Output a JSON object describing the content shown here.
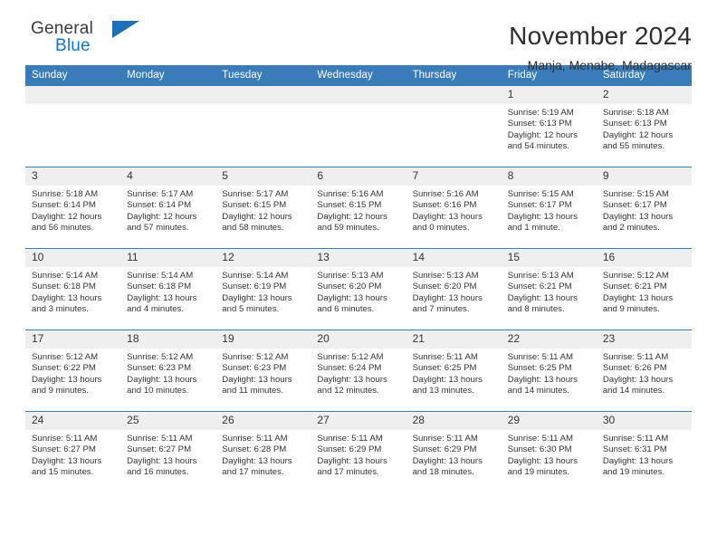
{
  "brand": {
    "name_part1": "General",
    "name_part2": "Blue",
    "accent_color": "#1277c4",
    "triangle_color": "#1f6fb6"
  },
  "header": {
    "title": "November 2024",
    "subtitle": "Manja, Menabe, Madagascar"
  },
  "theme": {
    "header_row_bg": "#3a7cba",
    "daynum_bg": "#efefef",
    "row_border": "#3a7cba"
  },
  "weekdays": [
    "Sunday",
    "Monday",
    "Tuesday",
    "Wednesday",
    "Thursday",
    "Friday",
    "Saturday"
  ],
  "labels": {
    "sunrise": "Sunrise:",
    "sunset": "Sunset:",
    "daylight": "Daylight:"
  },
  "weeks": [
    [
      {
        "day": "",
        "sunrise": "",
        "sunset": "",
        "daylight": ""
      },
      {
        "day": "",
        "sunrise": "",
        "sunset": "",
        "daylight": ""
      },
      {
        "day": "",
        "sunrise": "",
        "sunset": "",
        "daylight": ""
      },
      {
        "day": "",
        "sunrise": "",
        "sunset": "",
        "daylight": ""
      },
      {
        "day": "",
        "sunrise": "",
        "sunset": "",
        "daylight": ""
      },
      {
        "day": "1",
        "sunrise": "Sunrise: 5:19 AM",
        "sunset": "Sunset: 6:13 PM",
        "daylight": "Daylight: 12 hours and 54 minutes."
      },
      {
        "day": "2",
        "sunrise": "Sunrise: 5:18 AM",
        "sunset": "Sunset: 6:13 PM",
        "daylight": "Daylight: 12 hours and 55 minutes."
      }
    ],
    [
      {
        "day": "3",
        "sunrise": "Sunrise: 5:18 AM",
        "sunset": "Sunset: 6:14 PM",
        "daylight": "Daylight: 12 hours and 56 minutes."
      },
      {
        "day": "4",
        "sunrise": "Sunrise: 5:17 AM",
        "sunset": "Sunset: 6:14 PM",
        "daylight": "Daylight: 12 hours and 57 minutes."
      },
      {
        "day": "5",
        "sunrise": "Sunrise: 5:17 AM",
        "sunset": "Sunset: 6:15 PM",
        "daylight": "Daylight: 12 hours and 58 minutes."
      },
      {
        "day": "6",
        "sunrise": "Sunrise: 5:16 AM",
        "sunset": "Sunset: 6:15 PM",
        "daylight": "Daylight: 12 hours and 59 minutes."
      },
      {
        "day": "7",
        "sunrise": "Sunrise: 5:16 AM",
        "sunset": "Sunset: 6:16 PM",
        "daylight": "Daylight: 13 hours and 0 minutes."
      },
      {
        "day": "8",
        "sunrise": "Sunrise: 5:15 AM",
        "sunset": "Sunset: 6:17 PM",
        "daylight": "Daylight: 13 hours and 1 minute."
      },
      {
        "day": "9",
        "sunrise": "Sunrise: 5:15 AM",
        "sunset": "Sunset: 6:17 PM",
        "daylight": "Daylight: 13 hours and 2 minutes."
      }
    ],
    [
      {
        "day": "10",
        "sunrise": "Sunrise: 5:14 AM",
        "sunset": "Sunset: 6:18 PM",
        "daylight": "Daylight: 13 hours and 3 minutes."
      },
      {
        "day": "11",
        "sunrise": "Sunrise: 5:14 AM",
        "sunset": "Sunset: 6:18 PM",
        "daylight": "Daylight: 13 hours and 4 minutes."
      },
      {
        "day": "12",
        "sunrise": "Sunrise: 5:14 AM",
        "sunset": "Sunset: 6:19 PM",
        "daylight": "Daylight: 13 hours and 5 minutes."
      },
      {
        "day": "13",
        "sunrise": "Sunrise: 5:13 AM",
        "sunset": "Sunset: 6:20 PM",
        "daylight": "Daylight: 13 hours and 6 minutes."
      },
      {
        "day": "14",
        "sunrise": "Sunrise: 5:13 AM",
        "sunset": "Sunset: 6:20 PM",
        "daylight": "Daylight: 13 hours and 7 minutes."
      },
      {
        "day": "15",
        "sunrise": "Sunrise: 5:13 AM",
        "sunset": "Sunset: 6:21 PM",
        "daylight": "Daylight: 13 hours and 8 minutes."
      },
      {
        "day": "16",
        "sunrise": "Sunrise: 5:12 AM",
        "sunset": "Sunset: 6:21 PM",
        "daylight": "Daylight: 13 hours and 9 minutes."
      }
    ],
    [
      {
        "day": "17",
        "sunrise": "Sunrise: 5:12 AM",
        "sunset": "Sunset: 6:22 PM",
        "daylight": "Daylight: 13 hours and 9 minutes."
      },
      {
        "day": "18",
        "sunrise": "Sunrise: 5:12 AM",
        "sunset": "Sunset: 6:23 PM",
        "daylight": "Daylight: 13 hours and 10 minutes."
      },
      {
        "day": "19",
        "sunrise": "Sunrise: 5:12 AM",
        "sunset": "Sunset: 6:23 PM",
        "daylight": "Daylight: 13 hours and 11 minutes."
      },
      {
        "day": "20",
        "sunrise": "Sunrise: 5:12 AM",
        "sunset": "Sunset: 6:24 PM",
        "daylight": "Daylight: 13 hours and 12 minutes."
      },
      {
        "day": "21",
        "sunrise": "Sunrise: 5:11 AM",
        "sunset": "Sunset: 6:25 PM",
        "daylight": "Daylight: 13 hours and 13 minutes."
      },
      {
        "day": "22",
        "sunrise": "Sunrise: 5:11 AM",
        "sunset": "Sunset: 6:25 PM",
        "daylight": "Daylight: 13 hours and 14 minutes."
      },
      {
        "day": "23",
        "sunrise": "Sunrise: 5:11 AM",
        "sunset": "Sunset: 6:26 PM",
        "daylight": "Daylight: 13 hours and 14 minutes."
      }
    ],
    [
      {
        "day": "24",
        "sunrise": "Sunrise: 5:11 AM",
        "sunset": "Sunset: 6:27 PM",
        "daylight": "Daylight: 13 hours and 15 minutes."
      },
      {
        "day": "25",
        "sunrise": "Sunrise: 5:11 AM",
        "sunset": "Sunset: 6:27 PM",
        "daylight": "Daylight: 13 hours and 16 minutes."
      },
      {
        "day": "26",
        "sunrise": "Sunrise: 5:11 AM",
        "sunset": "Sunset: 6:28 PM",
        "daylight": "Daylight: 13 hours and 17 minutes."
      },
      {
        "day": "27",
        "sunrise": "Sunrise: 5:11 AM",
        "sunset": "Sunset: 6:29 PM",
        "daylight": "Daylight: 13 hours and 17 minutes."
      },
      {
        "day": "28",
        "sunrise": "Sunrise: 5:11 AM",
        "sunset": "Sunset: 6:29 PM",
        "daylight": "Daylight: 13 hours and 18 minutes."
      },
      {
        "day": "29",
        "sunrise": "Sunrise: 5:11 AM",
        "sunset": "Sunset: 6:30 PM",
        "daylight": "Daylight: 13 hours and 19 minutes."
      },
      {
        "day": "30",
        "sunrise": "Sunrise: 5:11 AM",
        "sunset": "Sunset: 6:31 PM",
        "daylight": "Daylight: 13 hours and 19 minutes."
      }
    ]
  ]
}
